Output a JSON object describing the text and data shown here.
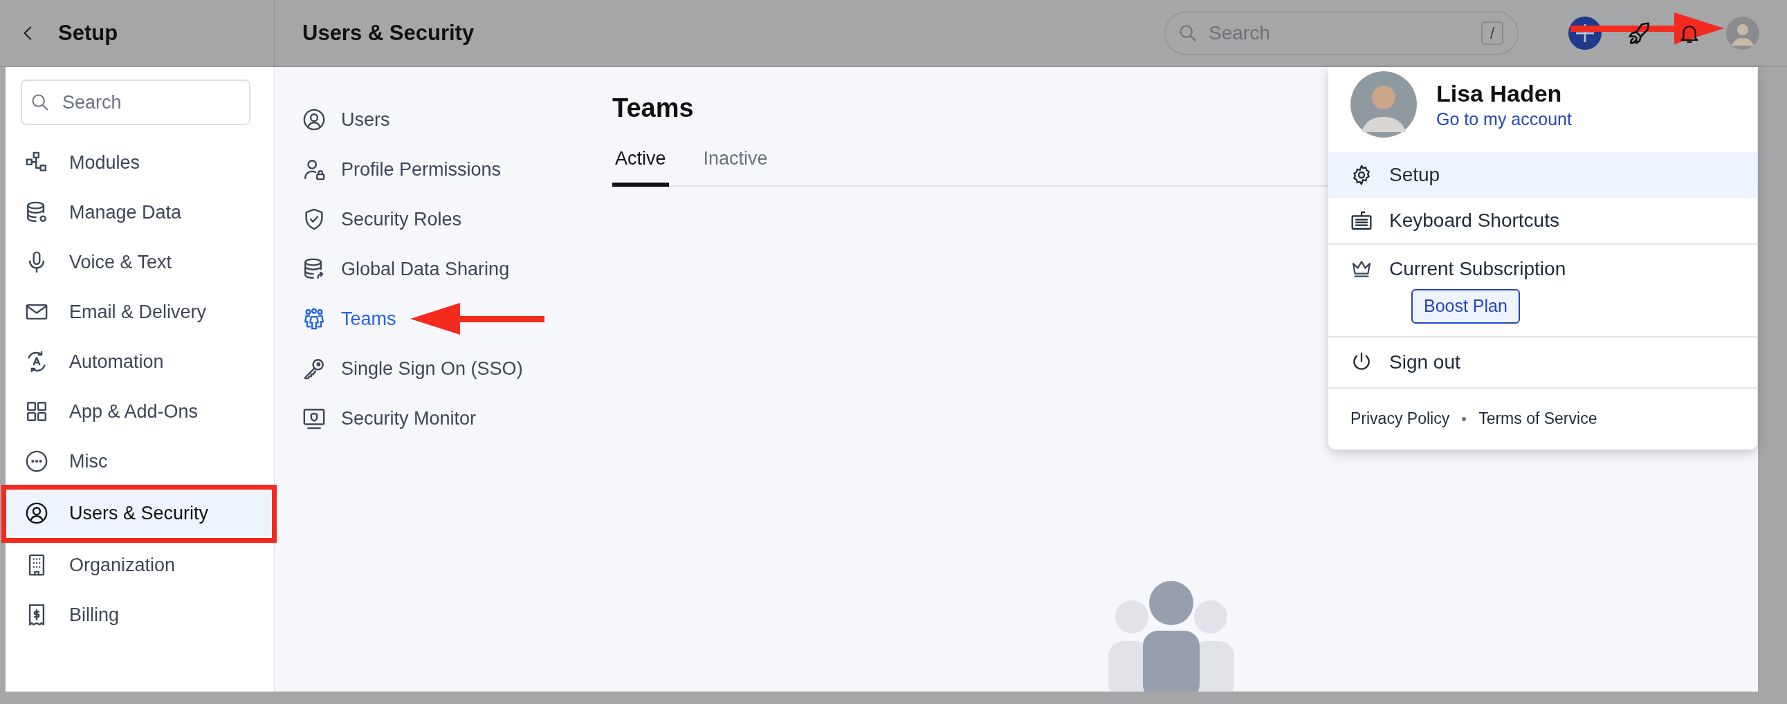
{
  "setup_header": {
    "title": "Setup"
  },
  "sidebar": {
    "search": {
      "placeholder": "Search"
    },
    "items": [
      {
        "label": "Modules",
        "selected": false
      },
      {
        "label": "Manage Data",
        "selected": false
      },
      {
        "label": "Voice & Text",
        "selected": false
      },
      {
        "label": "Email & Delivery",
        "selected": false
      },
      {
        "label": "Automation",
        "selected": false
      },
      {
        "label": "App & Add-Ons",
        "selected": false
      },
      {
        "label": "Misc",
        "selected": false
      },
      {
        "label": "Users & Security",
        "selected": true
      },
      {
        "label": "Organization",
        "selected": false
      },
      {
        "label": "Billing",
        "selected": false
      }
    ]
  },
  "topbar": {
    "title": "Users & Security",
    "search": {
      "placeholder": "Search",
      "shortcut": "/"
    }
  },
  "subnav": {
    "items": [
      {
        "label": "Users",
        "selected": false
      },
      {
        "label": "Profile Permissions",
        "selected": false
      },
      {
        "label": "Security Roles",
        "selected": false
      },
      {
        "label": "Global Data Sharing",
        "selected": false
      },
      {
        "label": "Teams",
        "selected": true
      },
      {
        "label": "Single Sign On (SSO)",
        "selected": false
      },
      {
        "label": "Security Monitor",
        "selected": false
      }
    ]
  },
  "content": {
    "title": "Teams",
    "tabs": [
      {
        "label": "Active",
        "selected": true
      },
      {
        "label": "Inactive",
        "selected": false
      }
    ]
  },
  "account_menu": {
    "name": "Lisa Haden",
    "account_link": "Go to my account",
    "items": [
      {
        "label": "Setup",
        "highlighted": true
      },
      {
        "label": "Keyboard Shortcuts",
        "highlighted": false
      }
    ],
    "subscription": {
      "label": "Current Subscription",
      "plan": "Boost Plan"
    },
    "sign_out": "Sign out",
    "footer_links": [
      "Privacy Policy",
      "Terms of Service"
    ]
  }
}
